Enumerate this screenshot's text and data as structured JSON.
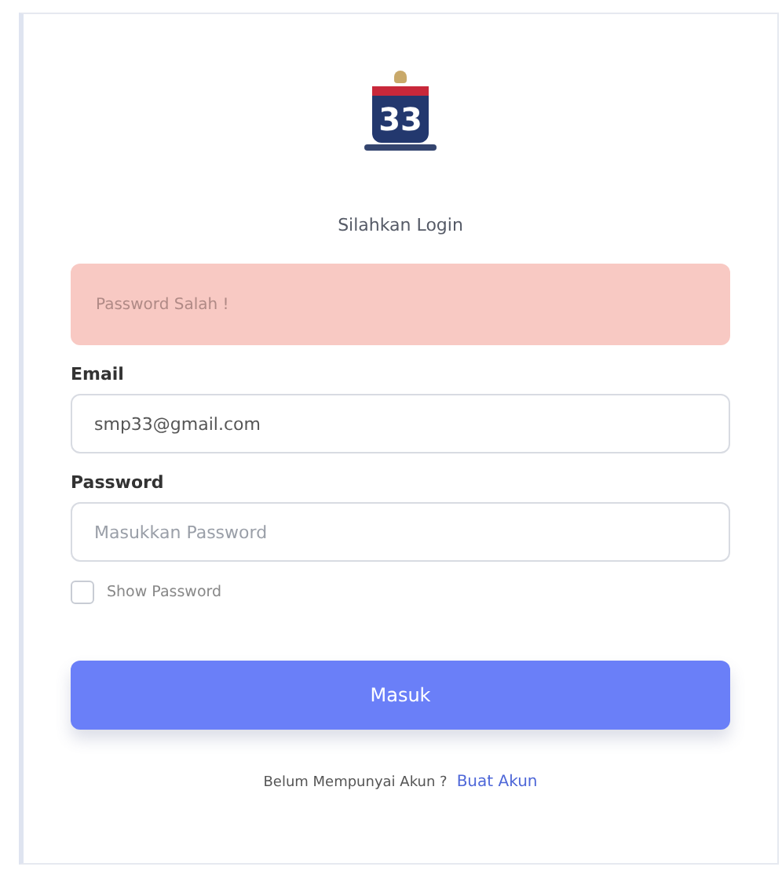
{
  "logo": {
    "number": "33"
  },
  "subtitle": "Silahkan Login",
  "alert": {
    "kind": "error",
    "message": "Password Salah !"
  },
  "fields": [
    {
      "label": "Email",
      "value": "smp33@gmail.com"
    },
    {
      "label": "Password",
      "placeholder": "Masukkan Password"
    }
  ],
  "show_password": {
    "label": "Show Password",
    "checked": false
  },
  "submit": "Masuk",
  "footer": {
    "text": "Belum Mempunyai Akun ?",
    "link": "Buat Akun"
  }
}
